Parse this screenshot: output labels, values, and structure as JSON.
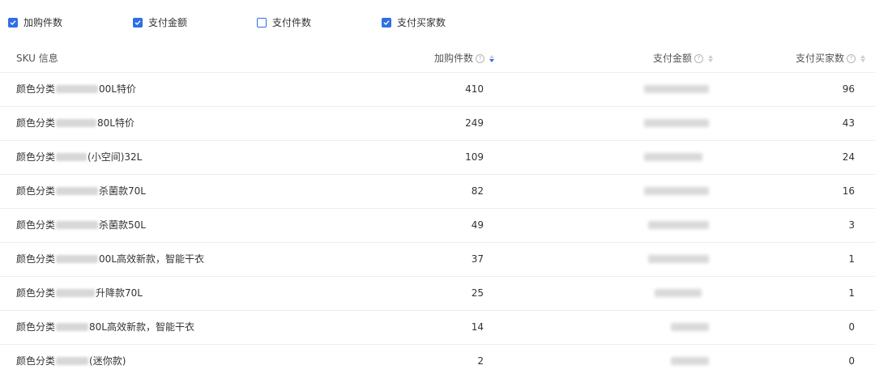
{
  "filters": [
    {
      "label": "加购件数",
      "checked": true
    },
    {
      "label": "支付金额",
      "checked": true
    },
    {
      "label": "支付件数",
      "checked": false
    },
    {
      "label": "支付买家数",
      "checked": true
    }
  ],
  "table": {
    "columns": {
      "sku": "SKU 信息",
      "cart": "加购件数",
      "amount": "支付金额",
      "buyers": "支付买家数"
    },
    "help_glyph": "?",
    "rows": [
      {
        "prefix": "颜色分类",
        "suffix": "00L特价",
        "cart": "410",
        "buyers": "96"
      },
      {
        "prefix": "颜色分类",
        "suffix": "80L特价",
        "cart": "249",
        "buyers": "43"
      },
      {
        "prefix": "颜色分类",
        "suffix": "(小空间)32L",
        "cart": "109",
        "buyers": "24"
      },
      {
        "prefix": "颜色分类",
        "suffix": "杀菌款70L",
        "cart": "82",
        "buyers": "16"
      },
      {
        "prefix": "颜色分类",
        "suffix": "杀菌款50L",
        "cart": "49",
        "buyers": "3"
      },
      {
        "prefix": "颜色分类",
        "suffix": "00L高效新款，智能干衣",
        "cart": "37",
        "buyers": "1"
      },
      {
        "prefix": "颜色分类",
        "suffix": "升降款70L",
        "cart": "25",
        "buyers": "1"
      },
      {
        "prefix": "颜色分类",
        "suffix": "80L高效新款，智能干衣",
        "cart": "14",
        "buyers": "0"
      },
      {
        "prefix": "颜色分类",
        "suffix": "(迷你款)",
        "cart": "2",
        "buyers": "0"
      }
    ]
  },
  "colors": {
    "accent": "#2f6fe4",
    "divider": "#eeeeee",
    "text": "#333333"
  }
}
